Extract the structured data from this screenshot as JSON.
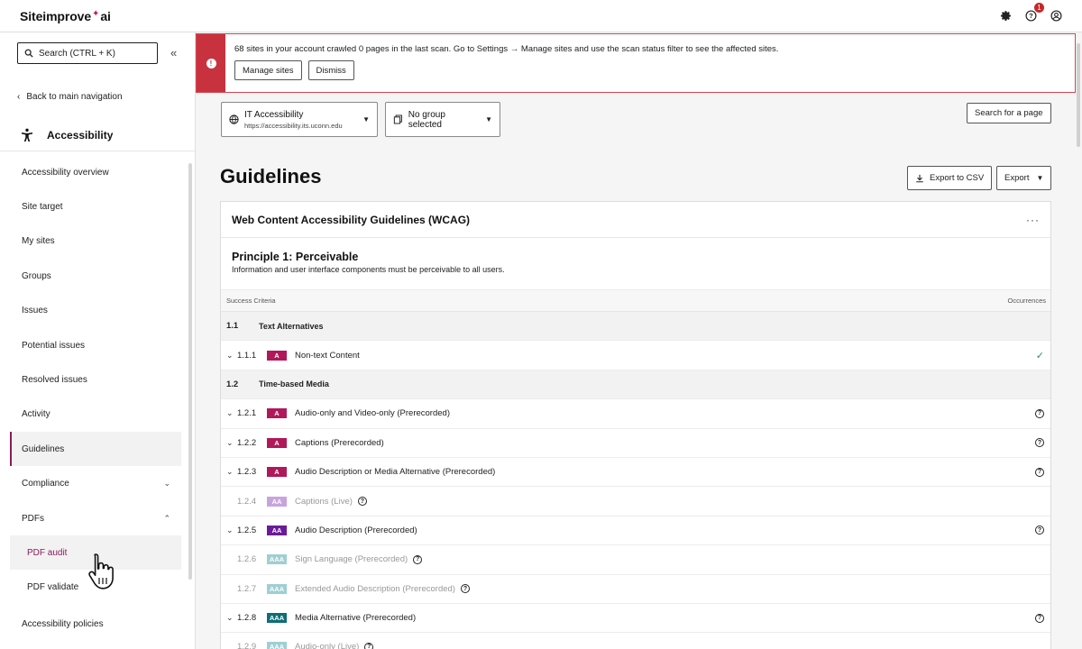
{
  "app": {
    "logo_main": "Siteimprove",
    "logo_suffix": "ai",
    "notification_count": "1"
  },
  "sidebar": {
    "search_placeholder": "Search   (CTRL + K)",
    "back_label": "Back to main navigation",
    "section_title": "Accessibility",
    "items": [
      {
        "label": "Accessibility overview"
      },
      {
        "label": "Site target"
      },
      {
        "label": "My sites"
      },
      {
        "label": "Groups"
      },
      {
        "label": "Issues"
      },
      {
        "label": "Potential issues"
      },
      {
        "label": "Resolved issues"
      },
      {
        "label": "Activity"
      },
      {
        "label": "Guidelines",
        "active": true
      },
      {
        "label": "Compliance",
        "expandable": true,
        "expanded": false
      },
      {
        "label": "PDFs",
        "expandable": true,
        "expanded": true
      },
      {
        "label": "PDF audit",
        "sub": true
      },
      {
        "label": "PDF validate",
        "sub": true
      },
      {
        "label": "Accessibility policies"
      }
    ]
  },
  "alert": {
    "message": "68 sites in your account crawled 0 pages in the last scan. Go to Settings → Manage sites and use the scan status filter to see the affected sites.",
    "manage_label": "Manage sites",
    "dismiss_label": "Dismiss"
  },
  "filters": {
    "site_name": "IT Accessibility",
    "site_url": "https://accessibility.its.uconn.edu",
    "group_label": "No group selected",
    "search_page_label": "Search for a page"
  },
  "page": {
    "title": "Guidelines",
    "export_csv_label": "Export to CSV",
    "export_label": "Export"
  },
  "card": {
    "title": "Web Content Accessibility Guidelines (WCAG)",
    "principle_title": "Principle 1: Perceivable",
    "principle_desc": "Information and user interface components must be perceivable to all users.",
    "col_criteria": "Success Criteria",
    "col_occurrences": "Occurrences",
    "rows": [
      {
        "type": "group",
        "num": "1.1",
        "label": "Text Alternatives"
      },
      {
        "type": "item",
        "num": "1.1.1",
        "level": "A",
        "label": "Non-text Content",
        "status": "check",
        "expandable": true
      },
      {
        "type": "group",
        "num": "1.2",
        "label": "Time-based Media"
      },
      {
        "type": "item",
        "num": "1.2.1",
        "level": "A",
        "label": "Audio-only and Video-only (Prerecorded)",
        "status": "help",
        "expandable": true
      },
      {
        "type": "item",
        "num": "1.2.2",
        "level": "A",
        "label": "Captions (Prerecorded)",
        "status": "help",
        "expandable": true
      },
      {
        "type": "item",
        "num": "1.2.3",
        "level": "A",
        "label": "Audio Description or Media Alternative (Prerecorded)",
        "status": "help",
        "expandable": true
      },
      {
        "type": "item",
        "num": "1.2.4",
        "level": "AA",
        "label": "Captions (Live)",
        "status": "inline-help",
        "muted": true
      },
      {
        "type": "item",
        "num": "1.2.5",
        "level": "AA",
        "label": "Audio Description (Prerecorded)",
        "status": "help",
        "expandable": true
      },
      {
        "type": "item",
        "num": "1.2.6",
        "level": "AAA",
        "label": "Sign Language (Prerecorded)",
        "status": "inline-help",
        "muted": true
      },
      {
        "type": "item",
        "num": "1.2.7",
        "level": "AAA",
        "label": "Extended Audio Description (Prerecorded)",
        "status": "inline-help",
        "muted": true
      },
      {
        "type": "item",
        "num": "1.2.8",
        "level": "AAA",
        "label": "Media Alternative (Prerecorded)",
        "status": "help",
        "expandable": true
      },
      {
        "type": "item",
        "num": "1.2.9",
        "level": "AAA",
        "label": "Audio-only (Live)",
        "status": "inline-help",
        "muted": true
      }
    ]
  },
  "colors": {
    "brand": "#8b1a5a",
    "alert": "#c8323f",
    "level_a": "#b0185a",
    "level_aa": "#6a1b9a",
    "level_aaa": "#0f6e76",
    "success": "#2e8b57"
  }
}
